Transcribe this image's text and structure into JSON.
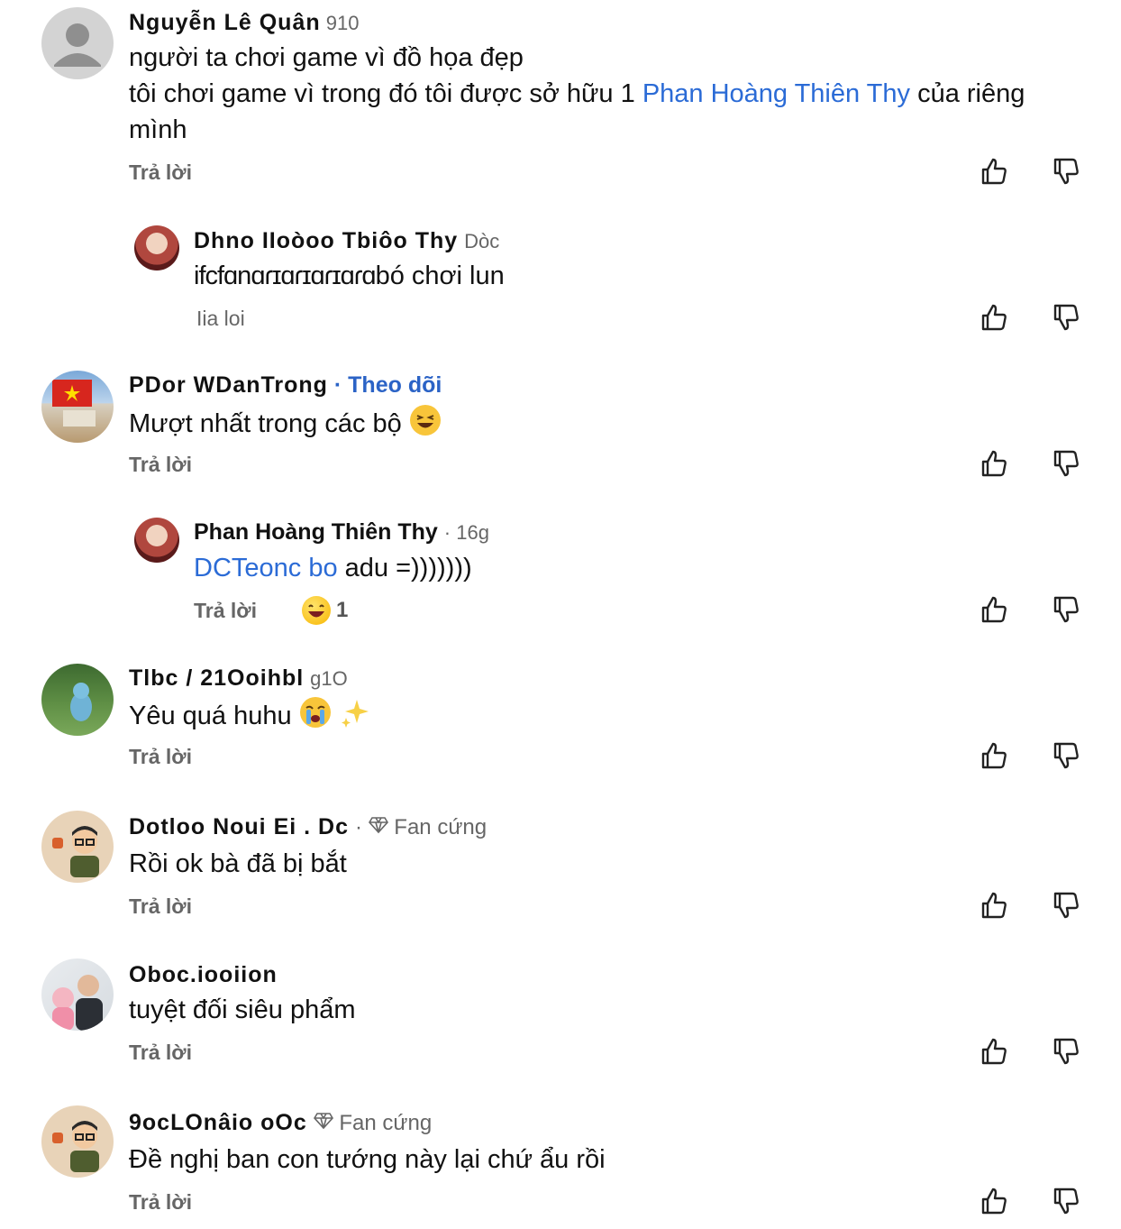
{
  "reply_label": "Trả lời",
  "comments": [
    {
      "name": "Nguyễn Lê Quân",
      "meta": " 910",
      "text_before": "người ta chơi game vì đồ họa đẹp",
      "text_line2_before": "tôi chơi game vì trong đó tôi được sở hữu 1 ",
      "mention": "Phan Hoàng Thiên Thy",
      "text_line2_after": " của riêng mình"
    },
    {
      "name": "Dhno IIoòoo Tbiôo Thy",
      "meta": "Dòc",
      "text": "bó chơi lun",
      "text_prefix": "ifcfɑnɑɾɪɑɾɪɑɾɪɑɾɑ",
      "reply": "Iia loi"
    },
    {
      "name": "PDor WDanTrong",
      "follow": "· Theo dõi",
      "text": "Mượt nhất trong các bộ"
    },
    {
      "name": "Phan Hoàng Thiên Thy",
      "meta": "· 16g",
      "mention": "DCTeonc bo",
      "text": " adu =)))))))",
      "reaction_count": "1"
    },
    {
      "name": "Tlbc / 21Ooihbl",
      "meta": "g1O",
      "text": "Yêu quá huhu"
    },
    {
      "name": "Dotloo Noui Ei . Dc",
      "fan": "Fan cứng",
      "text": "Rồi ok bà đã bị bắt"
    },
    {
      "name": "Oboc.iooiion",
      "text": "tuyệt đối siêu phẩm"
    },
    {
      "name": "9ocLOnâio  oOc",
      "fan": "Fan cứng",
      "text": "Đề nghị ban con tướng này lại chứ ẩu rồi"
    }
  ],
  "icons": {
    "like": "thumbs-up-icon",
    "dislike": "thumbs-down-icon",
    "diamond": "diamond-icon"
  },
  "colors": {
    "mention": "#2b6bd6",
    "follow": "#2b63c6",
    "muted": "#666666"
  }
}
